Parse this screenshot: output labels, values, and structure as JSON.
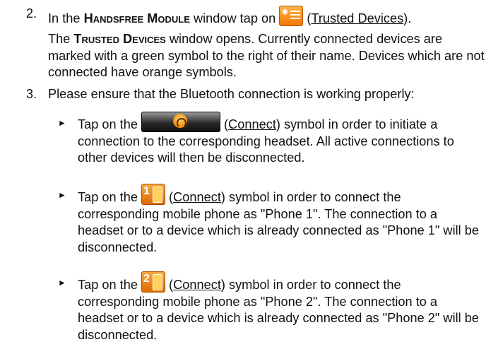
{
  "step2": {
    "number": "2.",
    "line1_before": "In the ",
    "handsfree": "Handsfree Module",
    "line1_mid": " window tap on ",
    "trusted_link": "Trusted Devices",
    "icon_trusted": "trusted-devices-icon",
    "trusted_title": "Trusted Devices",
    "para2_after": " window opens. Currently connected devices are marked with a green symbol to the right of their name. Devices which are not connected have orange symbols."
  },
  "step3": {
    "number": "3.",
    "text": "Please ensure that the Bluetooth connection is working properly:",
    "bullets": [
      {
        "marker": "►",
        "before": "Tap on the ",
        "link": "Connect",
        "icon": "connect-headset-icon",
        "after": " symbol in order to initiate a connection to the corresponding headset. All active connections to other devices will then be disconnected."
      },
      {
        "marker": "►",
        "before": "Tap on the ",
        "link": "Connect",
        "icon": "connect-phone1-icon",
        "icon_label": "1",
        "after": " symbol in order to connect the corresponding mobile phone as \"Phone 1\". The connection to a headset or to a device which is already connected as \"Phone 1\" will be disconnected."
      },
      {
        "marker": "►",
        "before": "Tap on the ",
        "link": "Connect",
        "icon": "connect-phone2-icon",
        "icon_label": "2",
        "after": " symbol in order to connect the corresponding mobile phone as \"Phone 2\". The connection to a headset or to a device which is already connected as \"Phone 2\" will be disconnected."
      }
    ]
  }
}
